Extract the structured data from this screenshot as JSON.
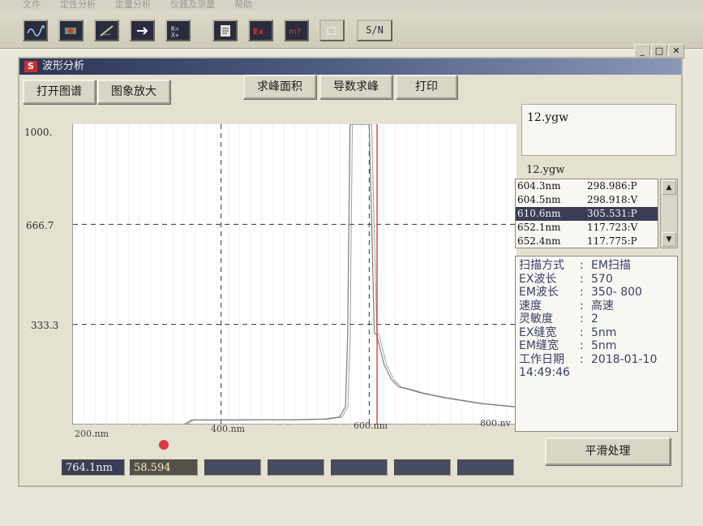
{
  "menubar": {
    "items": [
      "文件",
      "定性分析",
      "定量分析",
      "仪器及测量",
      "帮助"
    ]
  },
  "toolbar": {
    "buttons": [
      "spectrum-icon",
      "scan-icon",
      "measure-icon",
      "arrow-icon",
      "grid-icon",
      "doc-icon",
      "ex-icon",
      "em-icon",
      "blank-icon"
    ],
    "sn_label": "S/N"
  },
  "window": {
    "title": "波形分析",
    "buttons": {
      "open": "打开图谱",
      "zoom": "图象放大",
      "area": "求峰面积",
      "derivative": "导数求峰",
      "print": "打印"
    },
    "file_title": "12.ygw",
    "group_label": "12.ygw",
    "peaks": [
      {
        "wl": "604.3nm",
        "val": "298.986:P"
      },
      {
        "wl": "604.5nm",
        "val": "298.918:V"
      },
      {
        "wl": "610.6nm",
        "val": "305.531:P"
      },
      {
        "wl": "652.1nm",
        "val": "117.723:V"
      },
      {
        "wl": "652.4nm",
        "val": "117.775:P"
      }
    ],
    "info": [
      {
        "k": "扫描方式",
        "v": "EM扫描"
      },
      {
        "k": "EX波长",
        "v": "570"
      },
      {
        "k": "EM波长",
        "v": "350- 800"
      },
      {
        "k": "速度",
        "v": "高速"
      },
      {
        "k": "灵敏度",
        "v": "2"
      },
      {
        "k": "EX缝宽",
        "v": "5nm"
      },
      {
        "k": "EM缝宽",
        "v": "5nm"
      },
      {
        "k": "工作日期",
        "v": "2018-01-10"
      }
    ],
    "time": "14:49:46",
    "smooth_button": "平滑处理",
    "status": {
      "wavelength": "764.1nm",
      "value": "58.594"
    }
  },
  "chart_data": {
    "type": "line",
    "ylabels": [
      "1000.",
      "666.7",
      "333.3"
    ],
    "xlabels": [
      "200.nm",
      "400.nm",
      "600.nm",
      "800.nv"
    ],
    "xlim": [
      200,
      800
    ],
    "ylim": [
      0,
      1000
    ],
    "dashed_x": [
      400,
      600
    ],
    "dashed_y": [
      666.7,
      333.3
    ],
    "cursor_x": 610.6,
    "series": [
      {
        "x": [
          350,
          360,
          400,
          450,
          500,
          540,
          560,
          568,
          571,
          574,
          580,
          585,
          595,
          600,
          604,
          607,
          610,
          615,
          620,
          630,
          640,
          652,
          670,
          700,
          750,
          800
        ],
        "y": [
          0,
          15,
          15,
          16,
          16,
          18,
          25,
          60,
          300,
          1000,
          1000,
          1000,
          1000,
          1000,
          600,
          305,
          298,
          250,
          200,
          150,
          125,
          118,
          105,
          90,
          70,
          58
        ]
      }
    ]
  }
}
